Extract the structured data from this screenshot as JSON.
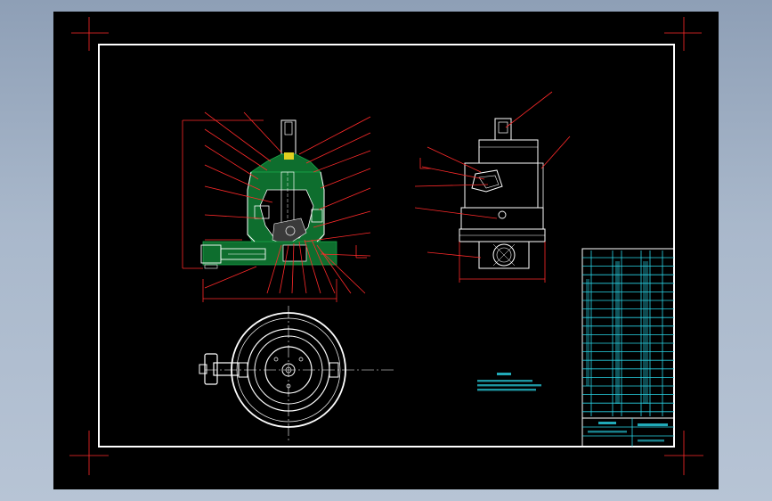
{
  "drawing": {
    "colors": {
      "background": "#000000",
      "frame": "#ffffff",
      "leaders": "#ff2a2a",
      "section_hatch": "#18a84a",
      "title_block": "#29d4e6"
    },
    "icons": [
      "crosshair-icon"
    ]
  }
}
